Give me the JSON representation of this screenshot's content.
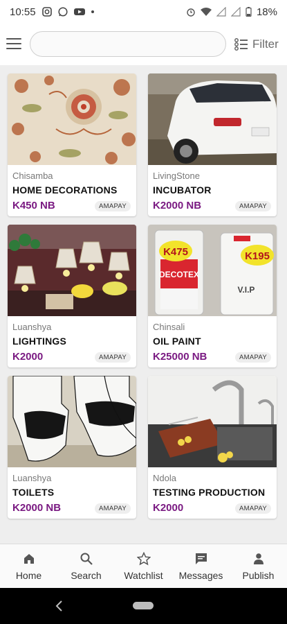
{
  "status_bar": {
    "time": "10:55",
    "battery": "18%",
    "left_icons": [
      "instagram-icon",
      "whatsapp-icon",
      "youtube-icon",
      "dot"
    ],
    "right_icons": [
      "alarm-icon",
      "wifi-icon",
      "signal-icon",
      "battery-icon"
    ]
  },
  "header": {
    "search_placeholder": "",
    "filter_label": "Filter"
  },
  "listings": [
    {
      "location": "Chisamba",
      "title": "HOME DECORATIONS",
      "price": "K450 NB",
      "badge": "AMAPAY"
    },
    {
      "location": "LivingStone",
      "title": "INCUBATOR",
      "price": "K2000 NB",
      "badge": "AMAPAY"
    },
    {
      "location": "Luanshya",
      "title": "LIGHTINGS",
      "price": "K2000",
      "badge": "AMAPAY"
    },
    {
      "location": "Chinsali",
      "title": "OIL PAINT",
      "price": "K25000 NB",
      "badge": "AMAPAY"
    },
    {
      "location": "Luanshya",
      "title": "TOILETS",
      "price": "K2000 NB",
      "badge": "AMAPAY"
    },
    {
      "location": "Ndola",
      "title": "TESTING PRODUCTION",
      "price": "K2000",
      "badge": "AMAPAY"
    }
  ],
  "image_text": {
    "paint_label_1": "DECOTEX",
    "paint_price_1": "K475",
    "paint_price_2": "K195",
    "paint_label_2": "V.I.P"
  },
  "bottom_nav": [
    {
      "label": "Home",
      "icon": "home-icon"
    },
    {
      "label": "Search",
      "icon": "search-icon"
    },
    {
      "label": "Watchlist",
      "icon": "star-icon"
    },
    {
      "label": "Messages",
      "icon": "message-icon"
    },
    {
      "label": "Publish",
      "icon": "person-icon"
    }
  ],
  "colors": {
    "price": "#7a1a82",
    "background": "#eeeeee",
    "card": "#ffffff"
  }
}
